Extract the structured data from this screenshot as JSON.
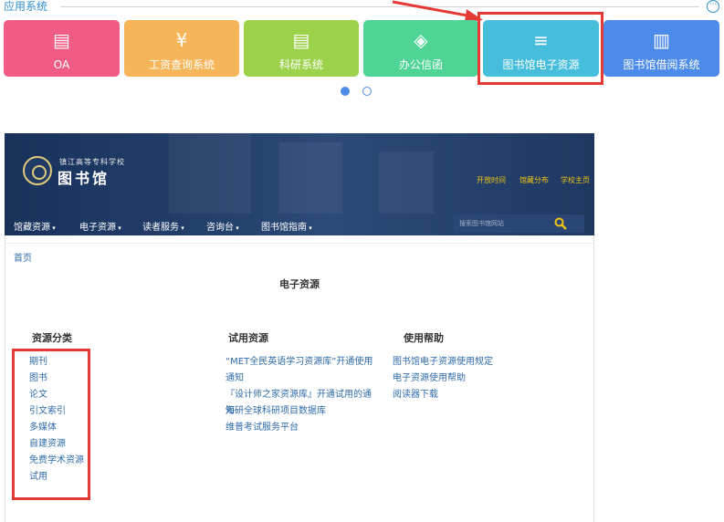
{
  "portal": {
    "section_title": "应用系统",
    "more_label": "···",
    "tiles": [
      {
        "label": "OA",
        "icon": "id-card-icon",
        "glyph": "▤",
        "color": "#f15c85"
      },
      {
        "label": "工资查询系统",
        "icon": "yen-icon",
        "glyph": "¥",
        "color": "#f5b558"
      },
      {
        "label": "科研系统",
        "icon": "id-card-icon",
        "glyph": "▤",
        "color": "#9cd14a"
      },
      {
        "label": "办公信函",
        "icon": "layers-icon",
        "glyph": "◈",
        "color": "#4fd495"
      },
      {
        "label": "图书馆电子资源",
        "icon": "database-icon",
        "glyph": "≡",
        "color": "#46bedb"
      },
      {
        "label": "图书馆借阅系统",
        "icon": "books-icon",
        "glyph": "▥",
        "color": "#4d8bea"
      }
    ],
    "annotation_color": "#e53935"
  },
  "library": {
    "logo_small": "镇江高等专科学校",
    "logo_big": "图书馆",
    "top_links": [
      "开放时间",
      "馆藏分布",
      "学校主页"
    ],
    "nav": [
      "馆藏资源",
      "电子资源",
      "读者服务",
      "咨询台",
      "图书馆指南"
    ],
    "search_placeholder": "搜索图书馆网站",
    "breadcrumb": "首页",
    "page_title": "电子资源",
    "columns": {
      "categories": {
        "heading": "资源分类",
        "items": [
          "期刊",
          "图书",
          "论文",
          "引文索引",
          "多媒体",
          "自建资源",
          "免费学术资源",
          "试用"
        ]
      },
      "trial": {
        "heading": "试用资源",
        "items": [
          "“MET全民英语学习资源库”开通使用通知",
          "『设计师之家资源库』开通试用的通知",
          "海研全球科研项目数据库",
          "维普考试服务平台"
        ]
      },
      "help": {
        "heading": "使用帮助",
        "items": [
          "图书馆电子资源使用规定",
          "电子资源使用帮助",
          "阅读器下载"
        ]
      }
    }
  }
}
